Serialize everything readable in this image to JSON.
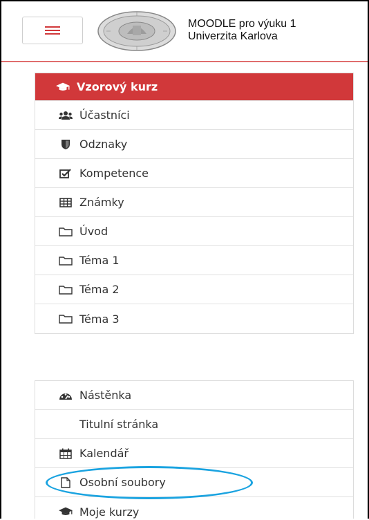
{
  "header": {
    "site_title_line1": "MOODLE pro výuku 1",
    "site_title_line2": "Univerzita Karlova",
    "menu_icon": "hamburger-icon",
    "logo": "university-seal-logo",
    "accent_color": "#d1383a"
  },
  "course_nav": {
    "course_title": "Vzorový kurz",
    "items": [
      {
        "label": "Účastníci",
        "icon": "users-icon"
      },
      {
        "label": "Odznaky",
        "icon": "shield-icon"
      },
      {
        "label": "Kompetence",
        "icon": "checkbox-icon"
      },
      {
        "label": "Známky",
        "icon": "table-icon"
      },
      {
        "label": "Úvod",
        "icon": "folder-icon"
      },
      {
        "label": "Téma 1",
        "icon": "folder-icon"
      },
      {
        "label": "Téma 2",
        "icon": "folder-icon"
      },
      {
        "label": "Téma 3",
        "icon": "folder-icon"
      }
    ]
  },
  "site_nav": {
    "items": [
      {
        "label": "Nástěnka",
        "icon": "dashboard-icon"
      },
      {
        "label": "Titulní stránka",
        "icon": ""
      },
      {
        "label": "Kalendář",
        "icon": "calendar-icon"
      },
      {
        "label": "Osobní soubory",
        "icon": "file-icon"
      },
      {
        "label": "Moje kurzy",
        "icon": "graduation-cap-icon"
      }
    ]
  },
  "highlight_color": "#1aa3e0"
}
